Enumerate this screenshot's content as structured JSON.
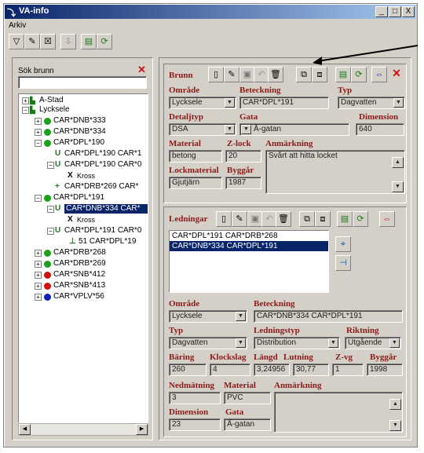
{
  "window": {
    "title": "VA-info",
    "minimize": "_",
    "maximize": "□",
    "close": "X"
  },
  "menu": {
    "arkiv": "Arkiv"
  },
  "search": {
    "label": "Sök brunn",
    "value": ""
  },
  "tree": {
    "nodes": [
      {
        "label": "A-Stad"
      },
      {
        "label": "Lycksele"
      },
      {
        "label": "CAR*DNB*333"
      },
      {
        "label": "CAR*DNB*334"
      },
      {
        "label": "CAR*DPL*190"
      },
      {
        "label": "CAR*DPL*190 CAR*1"
      },
      {
        "label": "CAR*DPL*190 CAR*0"
      },
      {
        "label": "Kross"
      },
      {
        "label": "CAR*DRB*269 CAR*"
      },
      {
        "label": "CAR*DPL*191"
      },
      {
        "label": "CAR*DNB*334 CAR*"
      },
      {
        "label": "Kross"
      },
      {
        "label": "CAR*DPL*191 CAR*0"
      },
      {
        "label": "51 CAR*DPL*19"
      },
      {
        "label": "CAR*DRB*268"
      },
      {
        "label": "CAR*DRB*269"
      },
      {
        "label": "CAR*SNB*412"
      },
      {
        "label": "CAR*SNB*413"
      },
      {
        "label": "CAR*VPLV*56"
      }
    ],
    "colors": {
      "green": "#1aa31a",
      "red": "#d01010",
      "blue": "#1020c0"
    }
  },
  "brunn": {
    "title": "Brunn",
    "omrade_label": "Område",
    "omrade": "Lycksele",
    "beteckning_label": "Beteckning",
    "beteckning": "CAR*DPL*191",
    "typ_label": "Typ",
    "typ": "Dagvatten",
    "detaljtyp_label": "Detaljtyp",
    "detaljtyp": "DSA",
    "gata_label": "Gata",
    "gata": "Å-gatan",
    "dimension_label": "Dimension",
    "dimension": "640",
    "material_label": "Material",
    "material": "betong",
    "zlock_label": "Z-lock",
    "zlock": "20",
    "anmarkning_label": "Anmärkning",
    "anmarkning": "Svårt att hitta locket",
    "lockmaterial_label": "Lockmaterial",
    "lockmaterial": "Gjutjärn",
    "byggar_label": "Byggår",
    "byggar": "1987"
  },
  "ledningar": {
    "title": "Ledningar",
    "items": [
      "CAR*DPL*191 CAR*DRB*268",
      "CAR*DNB*334 CAR*DPL*191"
    ],
    "omrade_label": "Område",
    "omrade": "Lycksele",
    "beteckning_label": "Beteckning",
    "beteckning": "CAR*DNB*334 CAR*DPL*191",
    "typ_label": "Typ",
    "typ": "Dagvatten",
    "ledningstyp_label": "Ledningstyp",
    "ledningstyp": "Distribution",
    "riktning_label": "Riktning",
    "riktning": "Utgående",
    "boring_label": "Bäring",
    "boring": "260",
    "klockslag_label": "Klockslag",
    "klockslag": "4",
    "langd_label": "Längd",
    "langd": "3,24956",
    "lutning_label": "Lutning",
    "lutning": "30,77",
    "zvg_label": "Z-vg",
    "zvg": "1",
    "byggar_label": "Byggår",
    "byggar": "1998",
    "nedmatning_label": "Nedmätning",
    "nedmatning": "3",
    "material_label": "Material",
    "material": "PVC",
    "anmarkning_label": "Anmärkning",
    "anmarkning": "",
    "dimension_label": "Dimension",
    "dimension": "23",
    "gata_label": "Gata",
    "gata": "Å-gatan"
  }
}
